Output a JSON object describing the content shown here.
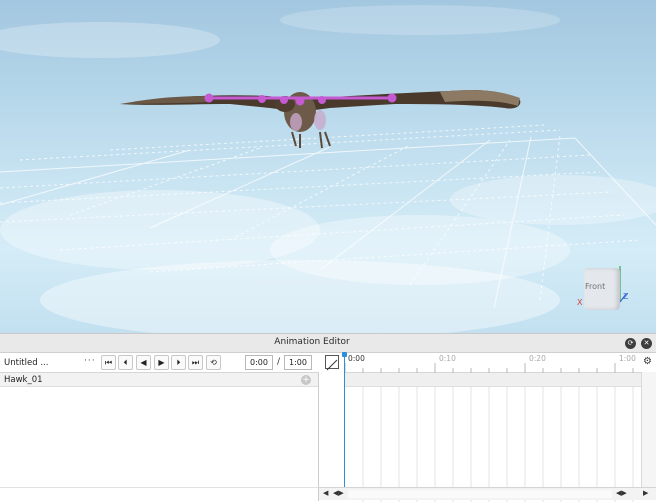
{
  "viewport": {
    "view_cube_label": "Front",
    "axis_x_label": "X",
    "axis_z_label": "Z"
  },
  "editor": {
    "title": "Animation Editor",
    "collapse_icon": "restore-icon",
    "close_icon": "close-icon",
    "animation_name": "Untitled ...",
    "more_button": "···",
    "playback_icons": {
      "to_start": "⏮",
      "prev_key": "⏴",
      "play_reverse": "◀",
      "play": "▶",
      "next_key": "⏵",
      "to_end": "⏭",
      "loop": "⟲"
    },
    "current_time": "0:00",
    "time_separator": "/",
    "total_time": "1:00",
    "tracks": [
      {
        "label": "Hawk_01"
      }
    ],
    "add_track_icon": "+",
    "timeline_ticks": [
      "0:00",
      "0:10",
      "0:20",
      "1:00"
    ],
    "settings_icon": "⚙",
    "scroll_left": "◀",
    "scroll_zoom_left": "◀▶",
    "scroll_zoom_right": "◀▶",
    "scroll_right": "▶"
  },
  "colors": {
    "scrubber": "#2e8fd8",
    "rig_joint": "#c55ad3"
  }
}
